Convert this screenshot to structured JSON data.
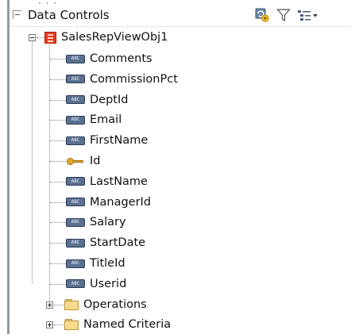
{
  "panel": {
    "title": "Data Controls",
    "tools": [
      "refresh-icon",
      "filter-icon",
      "view-options-icon"
    ]
  },
  "tree": {
    "root": {
      "label": "SalesRepViewObj1",
      "icon": "view-object-icon",
      "attributes": [
        {
          "label": "Comments",
          "icon": "attribute-icon"
        },
        {
          "label": "CommissionPct",
          "icon": "attribute-icon"
        },
        {
          "label": "DeptId",
          "icon": "attribute-icon"
        },
        {
          "label": "Email",
          "icon": "attribute-icon"
        },
        {
          "label": "FirstName",
          "icon": "attribute-icon"
        },
        {
          "label": "Id",
          "icon": "key-icon"
        },
        {
          "label": "LastName",
          "icon": "attribute-icon"
        },
        {
          "label": "ManagerId",
          "icon": "attribute-icon"
        },
        {
          "label": "Salary",
          "icon": "attribute-icon"
        },
        {
          "label": "StartDate",
          "icon": "attribute-icon"
        },
        {
          "label": "TitleId",
          "icon": "attribute-icon"
        },
        {
          "label": "Userid",
          "icon": "attribute-icon"
        }
      ],
      "folders": [
        {
          "label": "Operations",
          "icon": "folder-icon"
        },
        {
          "label": "Named Criteria",
          "icon": "folder-icon"
        }
      ]
    }
  }
}
